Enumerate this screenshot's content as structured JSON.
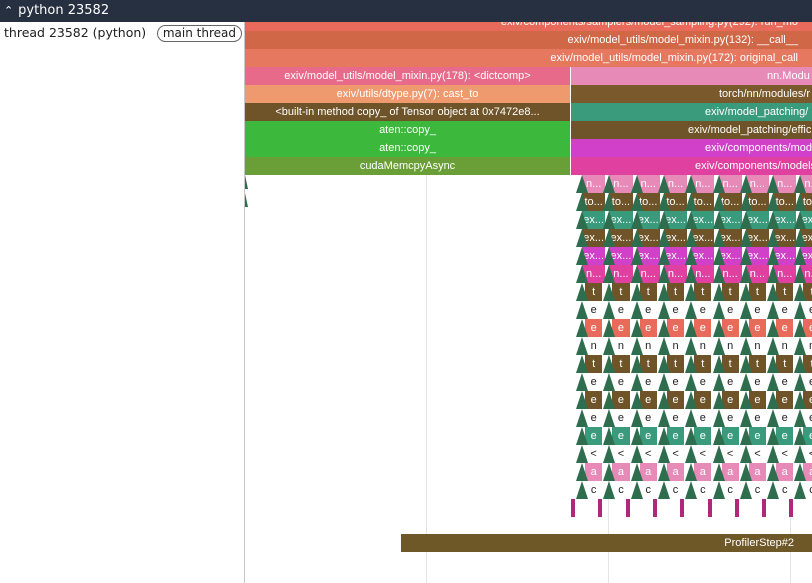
{
  "header": {
    "chevron_icon": "chevron-up-icon",
    "process_title": "python 23582"
  },
  "thread": {
    "label": "thread 23582 (python) 2...",
    "badge": "main thread"
  },
  "slices": {
    "row0_sampling": "exiv/components/samplers/model_sampling.py(292): run_mo",
    "row1_call": "exiv/model_utils/model_mixin.py(132): __call__",
    "row2_original_call": "exiv/model_utils/model_mixin.py(172): original_call",
    "row3_dictcomp": "exiv/model_utils/model_mixin.py(178): <dictcomp>",
    "row3_nn_module": "nn.Modu",
    "row4_cast_to": "exiv/utils/dtype.py(7): cast_to",
    "row4_torch_modules": "torch/nn/modules/r",
    "row5_copy_method": "<built-in method copy_ of Tensor object at 0x7472e8...",
    "row5_model_patching": "exiv/model_patching/",
    "row6_aten_copy": "aten::copy_",
    "row6_model_patching_effic": "exiv/model_patching/effic",
    "row7_aten_copy": "aten::copy_",
    "row7_components_mod": "exiv/components/mod",
    "row8_cuda_memcpy": "cudaMemcpyAsync",
    "row8_components_model": "exiv/components/models",
    "profiler_step": "ProfilerStep#2"
  },
  "repeated_labels": {
    "row9": "n...",
    "row10": "to...",
    "row11": "ex...",
    "row12": "ex...",
    "row13": "ex...",
    "row14": "n...",
    "row15": "t",
    "row16": "e",
    "row17": "e",
    "row18": "n",
    "row19": "t",
    "row20": "e",
    "row21": "e",
    "row22": "e",
    "row23": "e",
    "row24": "<",
    "row25": "a",
    "row26": "c"
  },
  "colors": {
    "titlebar": "#263040",
    "orange_red": "#d06848",
    "salmon": "#e67860",
    "pink": "#e86a8a",
    "light_pink": "#e88ab8",
    "peach": "#ef9a6e",
    "olive_brown": "#7a5a2c",
    "dark_olive": "#6e5428",
    "green_bright": "#3cb83c",
    "green_olive": "#6a9e36",
    "teal": "#3a9a7c",
    "magenta": "#d040c8",
    "magenta_pink": "#e040a0",
    "dark_green_tri": "#2e6e4e",
    "profiler_brown": "#6e5828"
  }
}
